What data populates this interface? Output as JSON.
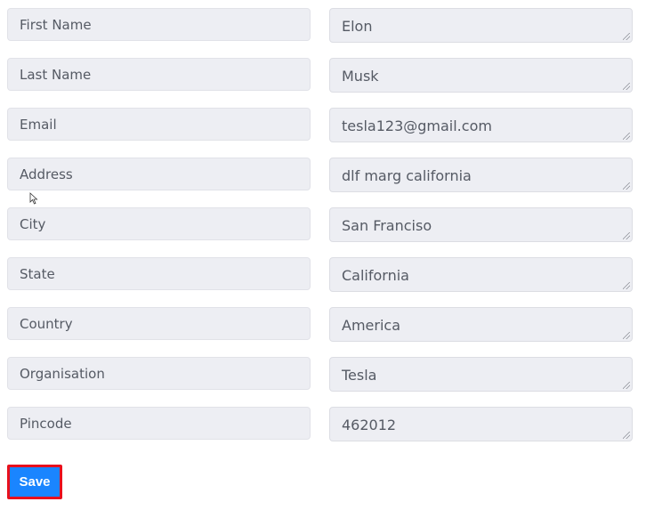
{
  "fields": [
    {
      "label": "First Name",
      "value": "Elon"
    },
    {
      "label": "Last Name",
      "value": "Musk"
    },
    {
      "label": "Email",
      "value": "tesla123@gmail.com"
    },
    {
      "label": "Address",
      "value": "dlf marg california"
    },
    {
      "label": "City",
      "value": "San Franciso"
    },
    {
      "label": "State",
      "value": "California"
    },
    {
      "label": "Country",
      "value": "America"
    },
    {
      "label": "Organisation",
      "value": "Tesla"
    },
    {
      "label": "Pincode",
      "value": "462012"
    }
  ],
  "save_label": "Save",
  "colors": {
    "button": "#1a85ff",
    "highlight": "#e8101d",
    "field_bg": "#edeef3"
  }
}
